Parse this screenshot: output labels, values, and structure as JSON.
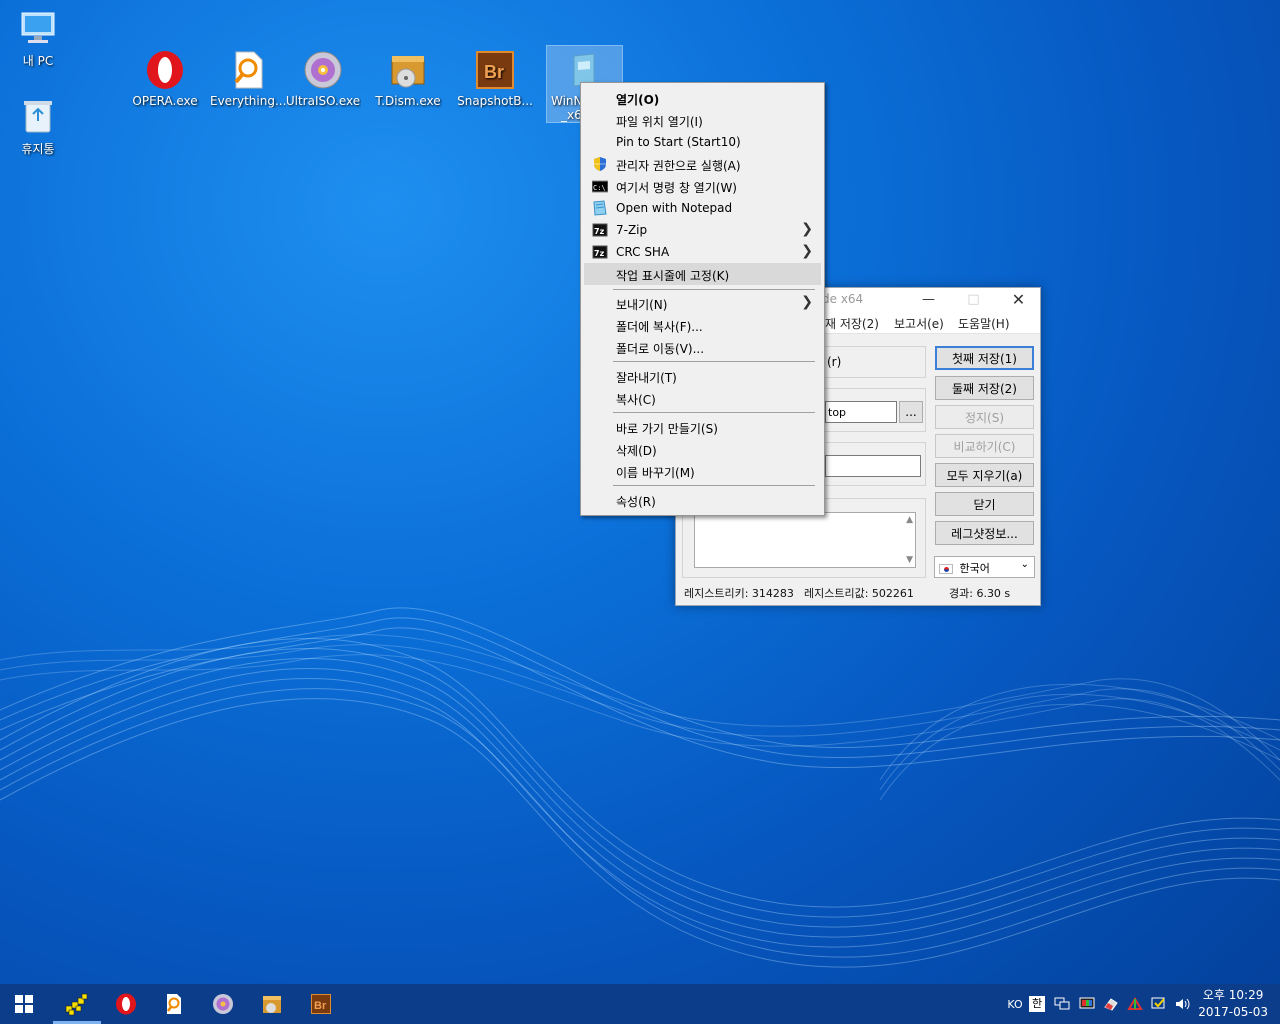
{
  "desktop": {
    "icons": [
      {
        "label": "내 PC"
      },
      {
        "label": "휴지통"
      },
      {
        "label": "OPERA.exe"
      },
      {
        "label": "Everything...."
      },
      {
        "label": "UltraISO.exe"
      },
      {
        "label": "T.Dism.exe"
      },
      {
        "label": "SnapshotB..."
      },
      {
        "label": "WinN"
      },
      {
        "label": "_x6"
      }
    ]
  },
  "app_window": {
    "title": "de x64",
    "menu": [
      "재 저장(2)",
      "보고서(e)",
      "도움말(H)"
    ],
    "fragments": {
      "r": "(r)",
      "path": "top",
      "browse": "..."
    },
    "buttons": [
      "첫째 저장(1)",
      "둘째 저장(2)",
      "정지(S)",
      "비교하기(C)",
      "모두 지우기(a)",
      "닫기",
      "레그샷정보..."
    ],
    "language": "한국어",
    "status": {
      "keys": "레지스트리키: 314283",
      "values": "레지스트리값: 502261",
      "elapsed": "경과: 6.30 s"
    }
  },
  "context_menu": {
    "items": [
      {
        "label": "열기(O)"
      },
      {
        "label": "파일 위치 열기(I)"
      },
      {
        "label": "Pin to Start (Start10)"
      },
      {
        "label": "관리자 권한으로 실행(A)"
      },
      {
        "label": "여기서 명령 창 열기(W)"
      },
      {
        "label": "Open with Notepad"
      },
      {
        "label": "7-Zip"
      },
      {
        "label": "CRC SHA"
      },
      {
        "label": "작업 표시줄에 고정(K)"
      },
      {
        "label": "보내기(N)"
      },
      {
        "label": "폴더에 복사(F)..."
      },
      {
        "label": "폴더로 이동(V)..."
      },
      {
        "label": "잘라내기(T)"
      },
      {
        "label": "복사(C)"
      },
      {
        "label": "바로 가기 만들기(S)"
      },
      {
        "label": "삭제(D)"
      },
      {
        "label": "이름 바꾸기(M)"
      },
      {
        "label": "속성(R)"
      }
    ]
  },
  "taskbar": {
    "tray": {
      "ime_lang": "KO",
      "ime_mode": "한"
    },
    "clock": {
      "time": "오후 10:29",
      "date": "2017-05-03"
    }
  }
}
